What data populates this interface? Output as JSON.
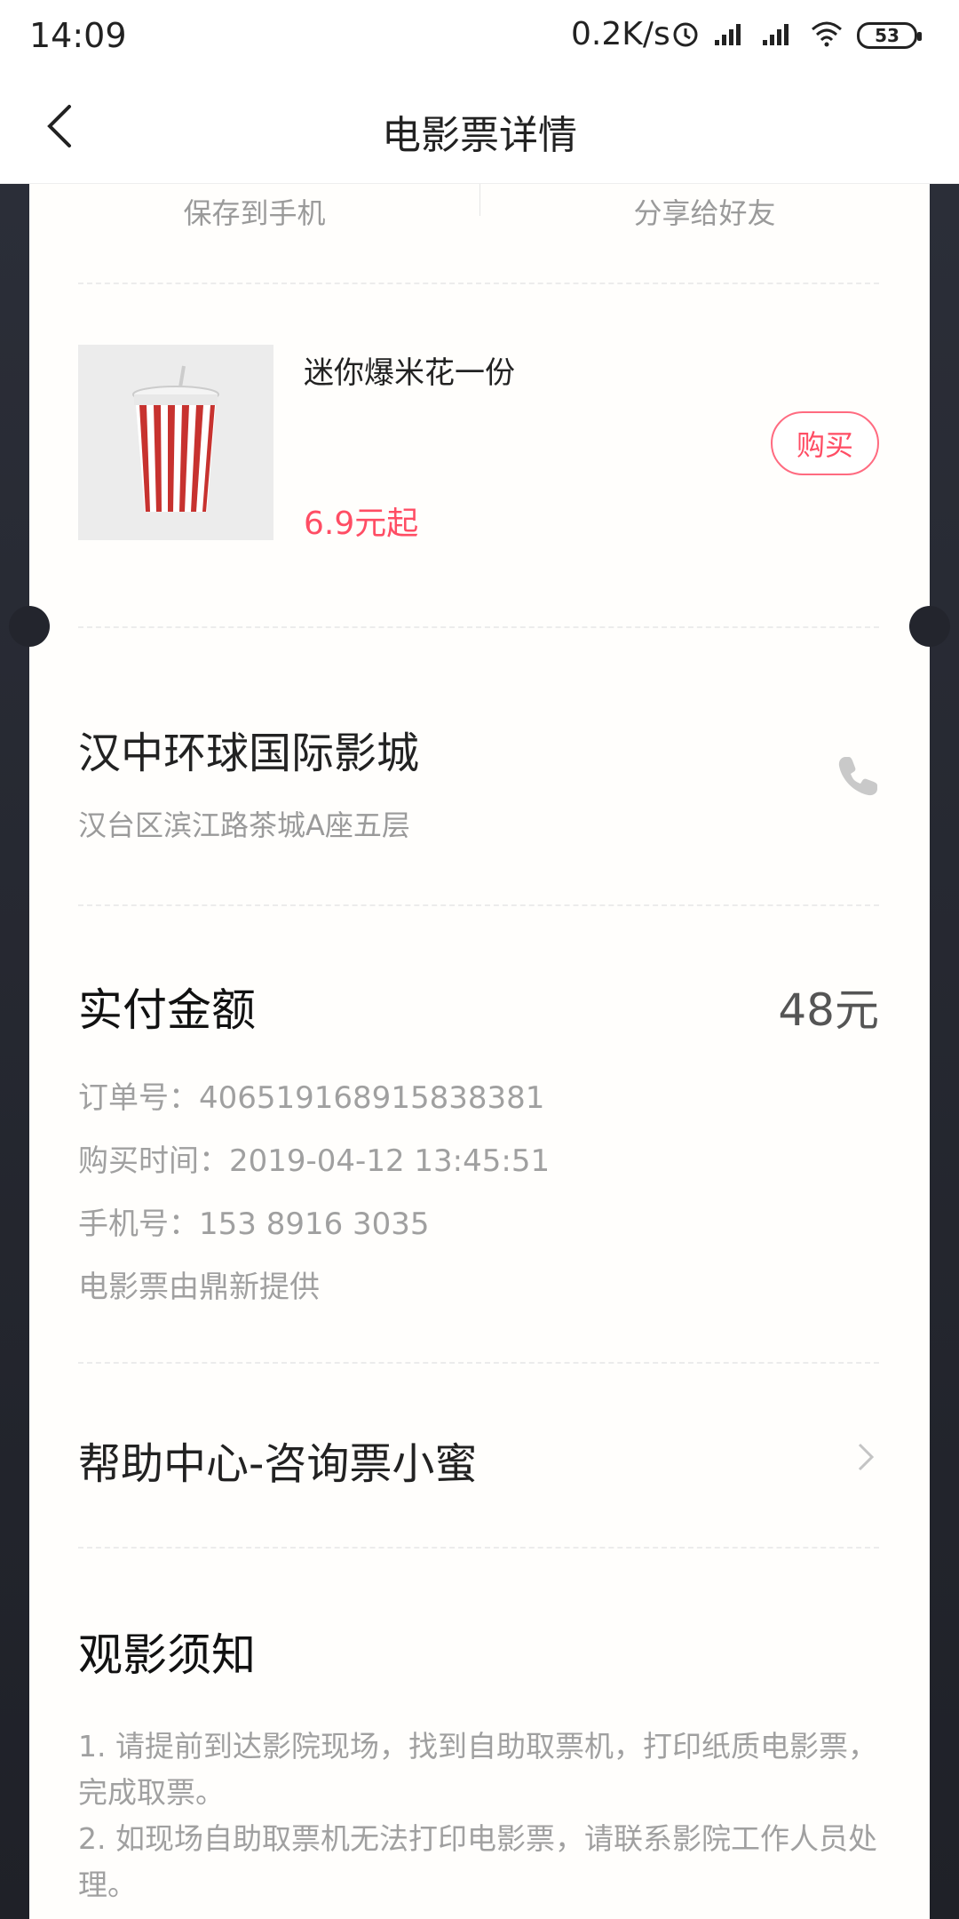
{
  "status": {
    "time": "14:09",
    "speed": "0.2K/s",
    "battery": "53"
  },
  "nav": {
    "title": "电影票详情"
  },
  "actions": {
    "save": "保存到手机",
    "share": "分享给好友"
  },
  "product": {
    "name": "迷你爆米花一份",
    "price": "6.9元起",
    "buy_label": "购买"
  },
  "cinema": {
    "name": "汉中环球国际影城",
    "address": "汉台区滨江路茶城A座五层"
  },
  "payment": {
    "label": "实付金额",
    "amount": "48元",
    "order_no": "订单号：406519168915838381",
    "purchase_time": "购买时间：2019-04-12 13:45:51",
    "phone": "手机号：153 8916 3035",
    "provider": "电影票由鼎新提供"
  },
  "help": {
    "label": "帮助中心-咨询票小蜜"
  },
  "notice": {
    "title": "观影须知",
    "line1": "1. 请提前到达影院现场，找到自助取票机，打印纸质电影票，完成取票。",
    "line2": "2. 如现场自助取票机无法打印电影票，请联系影院工作人员处理。"
  },
  "colors": {
    "accent": "#ff4d64",
    "dark_bg": "#23252d"
  }
}
